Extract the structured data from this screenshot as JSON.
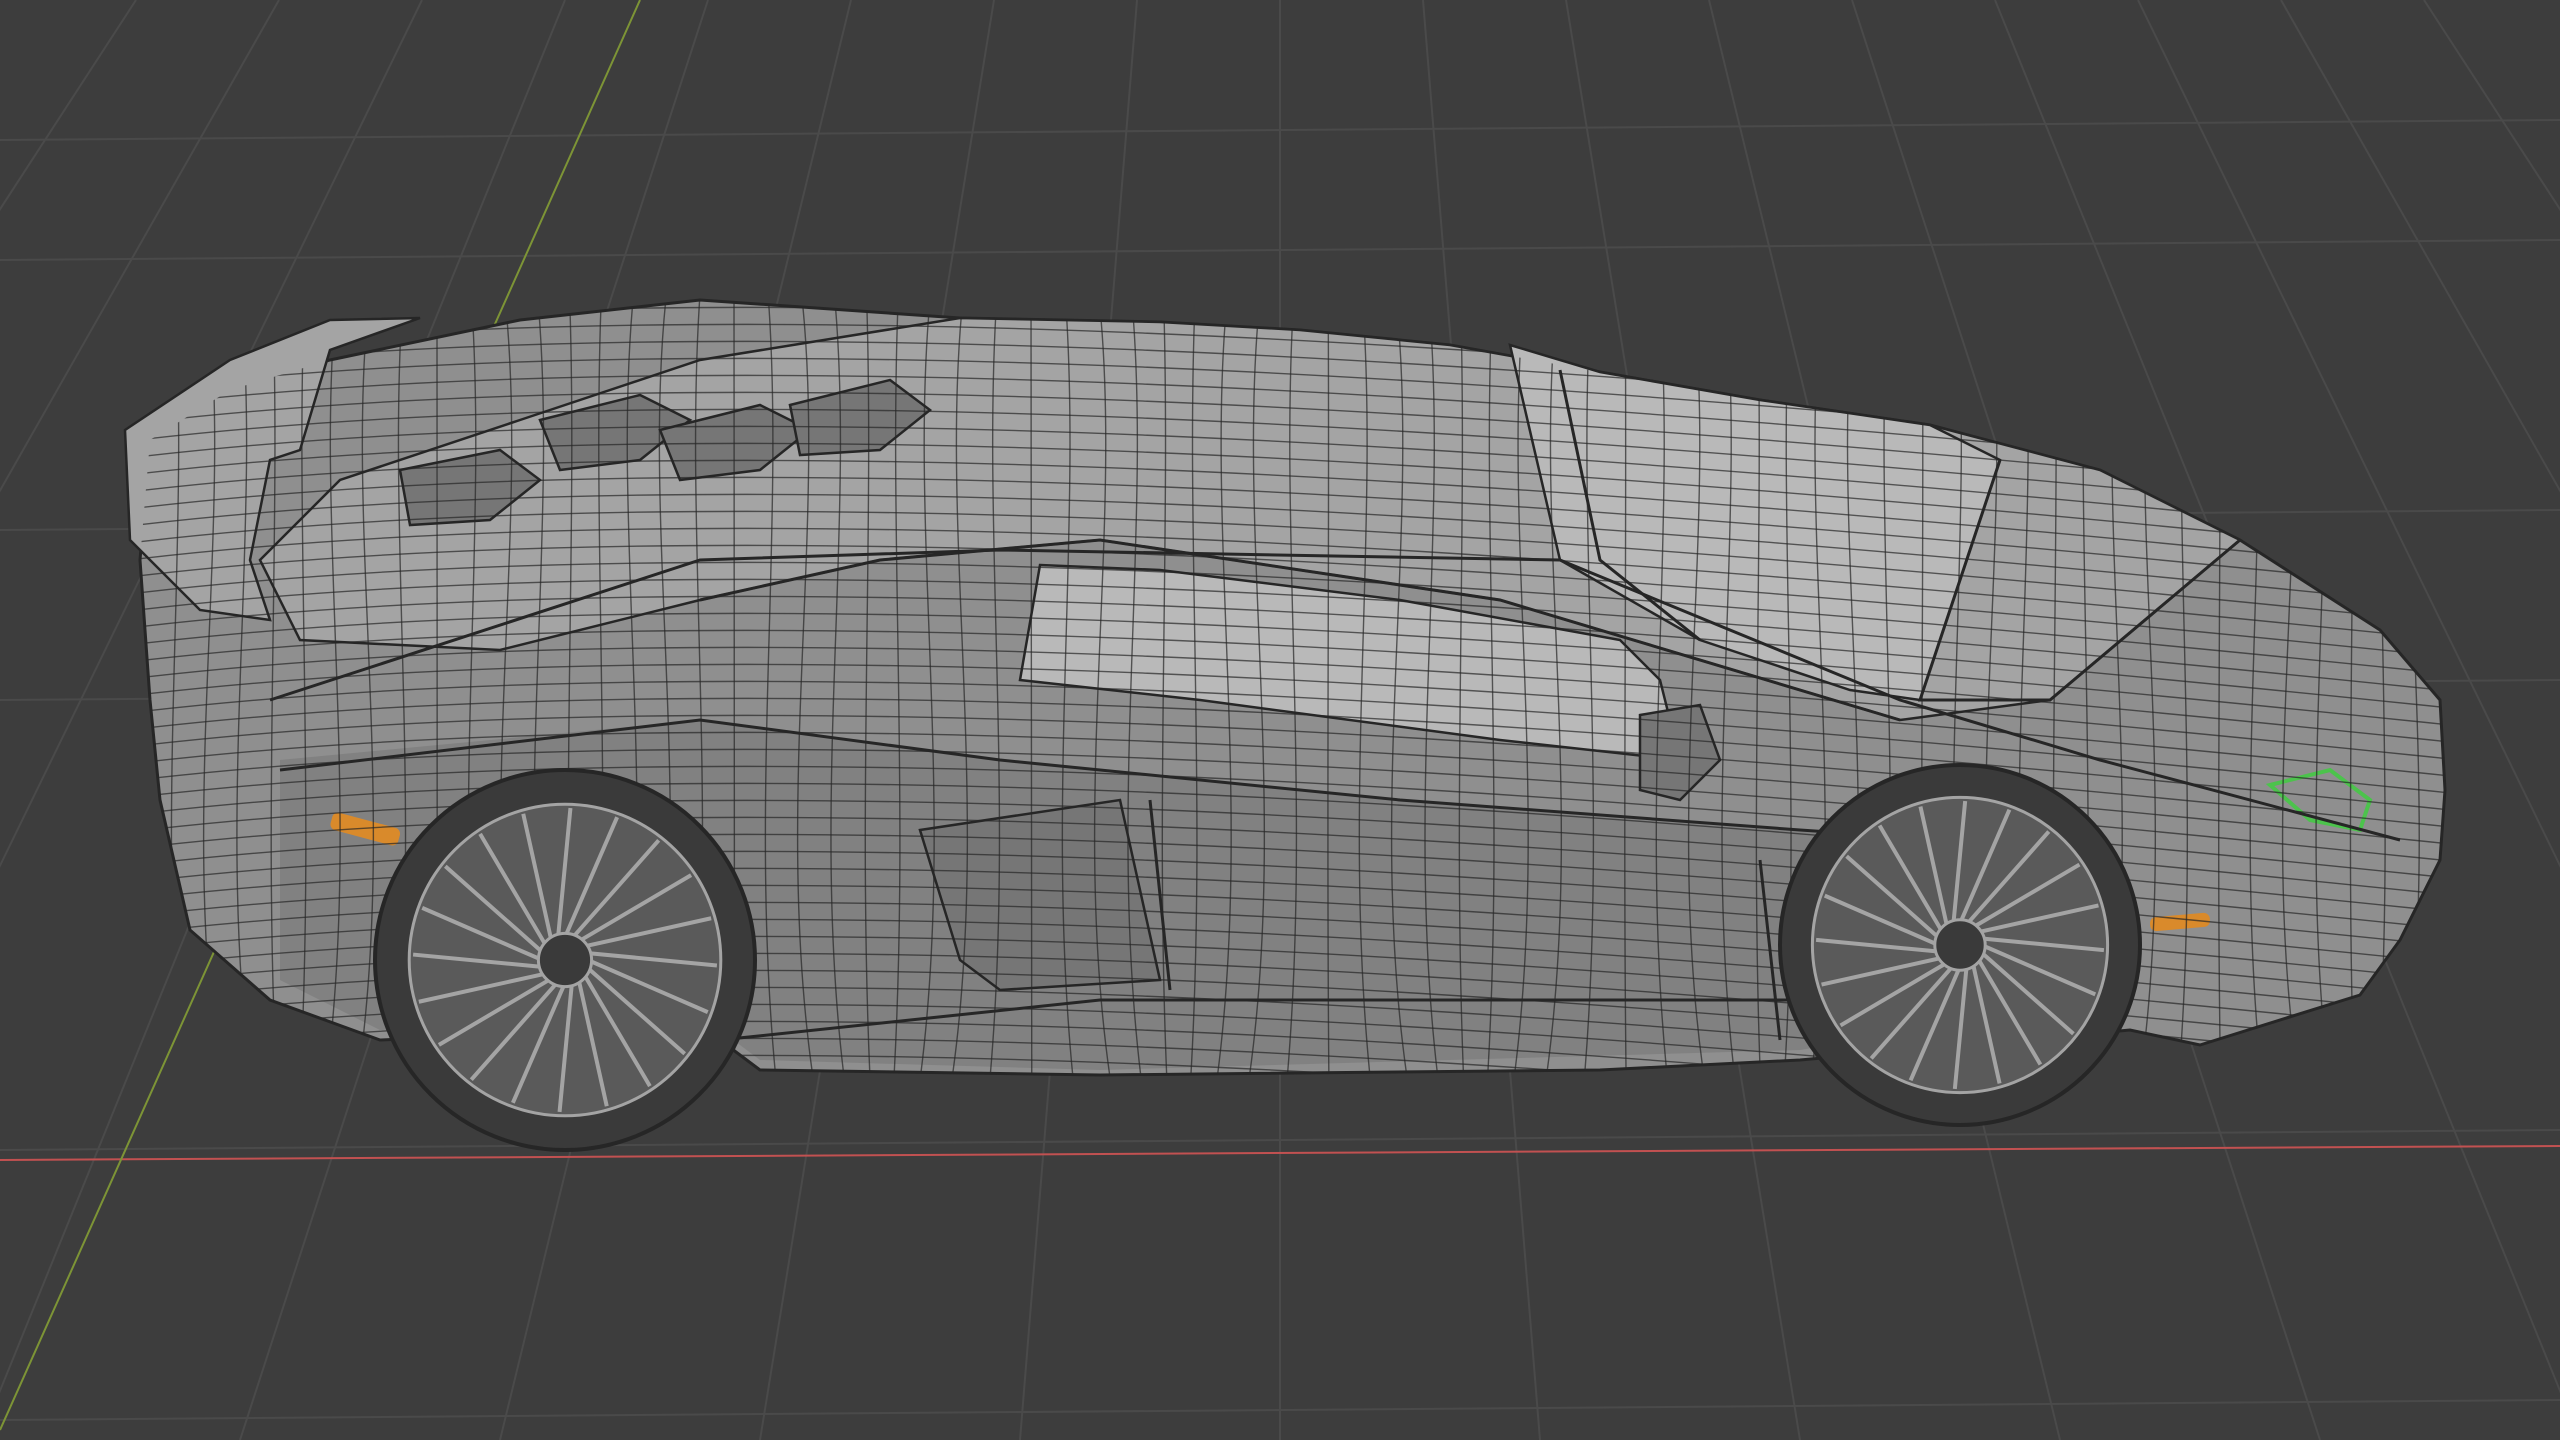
{
  "viewport": {
    "mode": "3D Viewport",
    "shading": "wireframe-over-solid",
    "background_color": "#3d3d3d",
    "grid_color": "#4a4a4a",
    "x_axis_color": "#c25151",
    "y_axis_color": "#7d9436"
  },
  "object": {
    "name": "car-model",
    "body_color": "#8f8f8f",
    "body_highlight": "#a4a4a4",
    "body_shadow": "#767676",
    "window_color": "#b9b9b9",
    "wire_color": "#262626",
    "wheel_color": "#5a5a5a",
    "tire_color": "#3a3a3a",
    "indicator_color": "#d98a2b",
    "selected_edge_color": "#4cc34c"
  }
}
